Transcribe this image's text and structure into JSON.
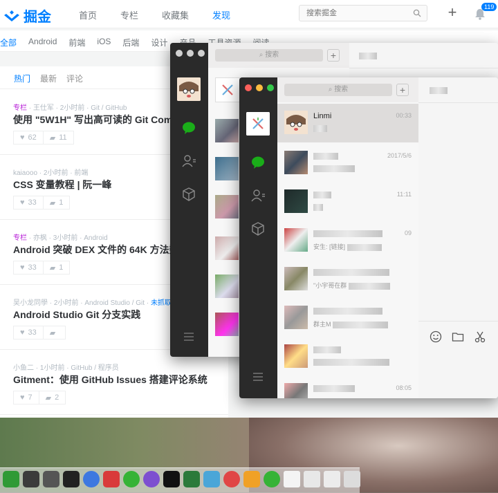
{
  "juejin": {
    "logo_text": "掘金",
    "nav": [
      "首页",
      "专栏",
      "收藏集",
      "发现"
    ],
    "nav_active": 3,
    "search_placeholder": "搜索掘金",
    "notification_count": "119",
    "categories": [
      "全部",
      "Android",
      "前端",
      "iOS",
      "后端",
      "设计",
      "产品",
      "工具资源",
      "阅读"
    ],
    "feed_tabs": [
      "热门",
      "最新",
      "评论"
    ],
    "articles": [
      {
        "tag": "专栏",
        "meta": " · 王仕军 · 2小时前 · Git / GitHub",
        "title": "使用 \"5W1H\" 写出高可读的 Git Commit",
        "likes": "62",
        "comments": "11"
      },
      {
        "tag": "",
        "meta": "kaiaooo · 2小时前 · 前端",
        "title": "CSS 变量教程 | 阮一峰",
        "likes": "33",
        "comments": "1"
      },
      {
        "tag": "专栏",
        "meta": " · 亦枫 · 3小时前 · Android",
        "title": "Android 突破 DEX 文件的 64K 方法数限制",
        "likes": "33",
        "comments": "1"
      },
      {
        "tag": "",
        "meta": "吴小龙同學 · 2小时前 · Android Studio / Git · ",
        "meta_extra": "未抓取",
        "title": "Android Studio Git 分支实践",
        "likes": "33",
        "comments": ""
      },
      {
        "tag": "",
        "meta": "小鱼二 · 1小时前 · GitHub / 程序员",
        "title": "Gitment：使用 GitHub Issues 搭建评论系统",
        "likes": "7",
        "comments": "2"
      }
    ]
  },
  "wechat_back": {
    "search_placeholder": "搜索",
    "add_label": "+"
  },
  "wechat_front": {
    "search_placeholder": "搜索",
    "add_label": "+",
    "conversations": [
      {
        "name": "Linmi",
        "sub": "",
        "time": "00:33",
        "selected": true
      },
      {
        "name": "",
        "sub": "",
        "time": "2017/5/6"
      },
      {
        "name": "",
        "sub": "",
        "time": "11:11"
      },
      {
        "name": "",
        "sub": "安生: [链接]",
        "time": "09"
      },
      {
        "name": "",
        "sub": "\"小宇哥在群",
        "time": ""
      },
      {
        "name": "",
        "sub": "群主M",
        "time": ""
      },
      {
        "name": "",
        "sub": "",
        "time": ""
      },
      {
        "name": "",
        "sub": "",
        "time": "08:05"
      }
    ]
  },
  "colors": {
    "accent": "#007fff",
    "wechat_green": "#1aad19",
    "zhuanlan_purple": "#b71ed7"
  }
}
